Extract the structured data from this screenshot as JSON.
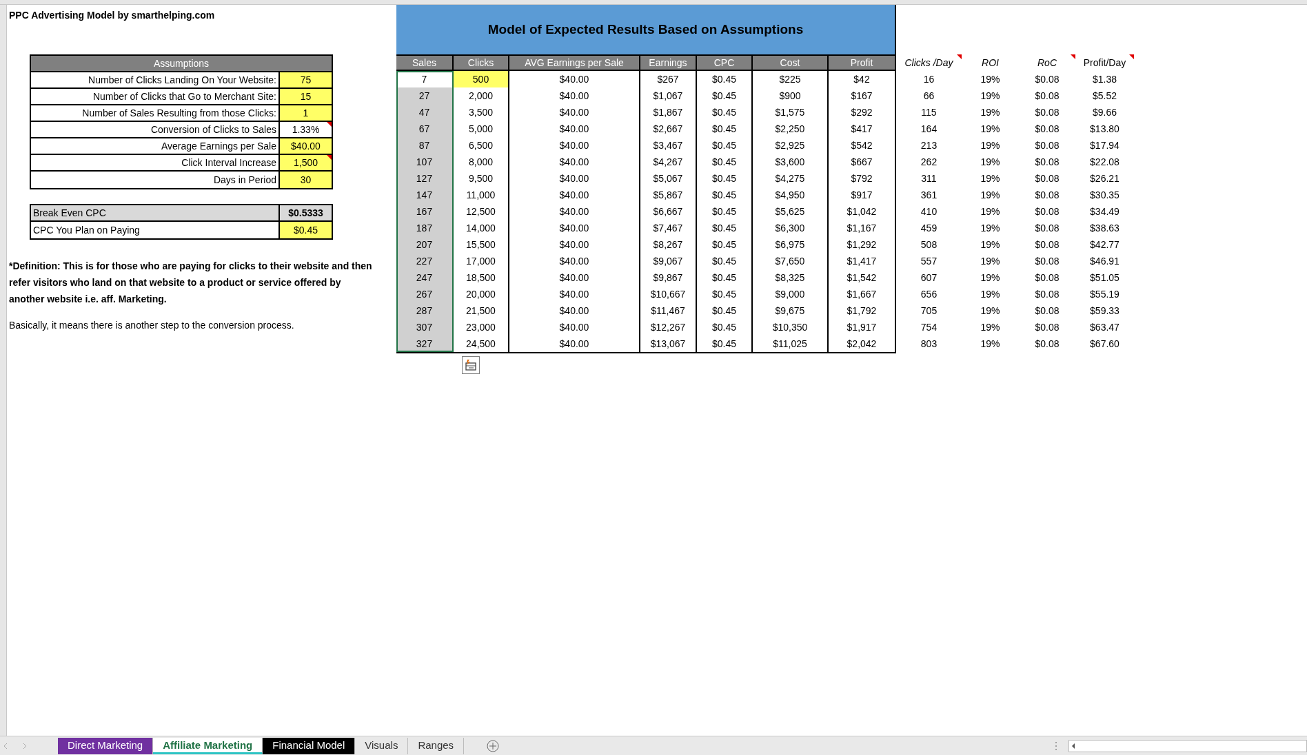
{
  "sheet_title": "PPC Advertising Model by smarthelping.com",
  "assumptions": {
    "title": "Assumptions",
    "rows": [
      {
        "label": "Number of Clicks Landing On Your Website:",
        "value": "75",
        "input": true,
        "comment": false
      },
      {
        "label": "Number of Clicks that Go to Merchant Site:",
        "value": "15",
        "input": true,
        "comment": false
      },
      {
        "label": "Number of Sales Resulting from those Clicks:",
        "value": "1",
        "input": true,
        "comment": false
      },
      {
        "label": "Conversion of Clicks to Sales",
        "value": "1.33%",
        "input": false,
        "comment": true
      },
      {
        "label": "Average Earnings per Sale",
        "value": "$40.00",
        "input": true,
        "comment": false
      },
      {
        "label": "Click Interval Increase",
        "value": "1,500",
        "input": true,
        "comment": true
      },
      {
        "label": "Days in Period",
        "value": "30",
        "input": true,
        "comment": false
      }
    ]
  },
  "cpc": [
    {
      "label": "Break Even CPC",
      "value": "$0.5333",
      "input": false
    },
    {
      "label": "CPC You Plan on Paying",
      "value": "$0.45",
      "input": true
    }
  ],
  "definition": "*Definition: This is for those who are paying for clicks to their website and then refer visitors who land on that website to a product or service offered by another website i.e. aff. Marketing.",
  "note": "Basically, it means there is another step to the conversion process.",
  "model": {
    "title": "Model of Expected Results Based on Assumptions",
    "columns": [
      "Sales",
      "Clicks",
      "AVG Earnings per Sale",
      "Earnings",
      "CPC",
      "Cost",
      "Profit"
    ],
    "extra_columns": [
      {
        "label": "Clicks /Day",
        "italic": true,
        "comment": true
      },
      {
        "label": "ROI",
        "italic": true,
        "comment": false
      },
      {
        "label": "RoC",
        "italic": true,
        "comment": true
      },
      {
        "label": "Profit/Day",
        "italic": false,
        "comment": true
      }
    ],
    "rows": [
      {
        "cells": [
          "7",
          "500",
          "$40.00",
          "$267",
          "$0.45",
          "$225",
          "$42",
          "16",
          "19%",
          "$0.08",
          "$1.38"
        ],
        "sales_in_selection": false,
        "clicks_input": true
      },
      {
        "cells": [
          "27",
          "2,000",
          "$40.00",
          "$1,067",
          "$0.45",
          "$900",
          "$167",
          "66",
          "19%",
          "$0.08",
          "$5.52"
        ],
        "sales_in_selection": true,
        "clicks_input": false
      },
      {
        "cells": [
          "47",
          "3,500",
          "$40.00",
          "$1,867",
          "$0.45",
          "$1,575",
          "$292",
          "115",
          "19%",
          "$0.08",
          "$9.66"
        ],
        "sales_in_selection": true,
        "clicks_input": false
      },
      {
        "cells": [
          "67",
          "5,000",
          "$40.00",
          "$2,667",
          "$0.45",
          "$2,250",
          "$417",
          "164",
          "19%",
          "$0.08",
          "$13.80"
        ],
        "sales_in_selection": true,
        "clicks_input": false
      },
      {
        "cells": [
          "87",
          "6,500",
          "$40.00",
          "$3,467",
          "$0.45",
          "$2,925",
          "$542",
          "213",
          "19%",
          "$0.08",
          "$17.94"
        ],
        "sales_in_selection": true,
        "clicks_input": false
      },
      {
        "cells": [
          "107",
          "8,000",
          "$40.00",
          "$4,267",
          "$0.45",
          "$3,600",
          "$667",
          "262",
          "19%",
          "$0.08",
          "$22.08"
        ],
        "sales_in_selection": true,
        "clicks_input": false
      },
      {
        "cells": [
          "127",
          "9,500",
          "$40.00",
          "$5,067",
          "$0.45",
          "$4,275",
          "$792",
          "311",
          "19%",
          "$0.08",
          "$26.21"
        ],
        "sales_in_selection": true,
        "clicks_input": false
      },
      {
        "cells": [
          "147",
          "11,000",
          "$40.00",
          "$5,867",
          "$0.45",
          "$4,950",
          "$917",
          "361",
          "19%",
          "$0.08",
          "$30.35"
        ],
        "sales_in_selection": true,
        "clicks_input": false
      },
      {
        "cells": [
          "167",
          "12,500",
          "$40.00",
          "$6,667",
          "$0.45",
          "$5,625",
          "$1,042",
          "410",
          "19%",
          "$0.08",
          "$34.49"
        ],
        "sales_in_selection": true,
        "clicks_input": false
      },
      {
        "cells": [
          "187",
          "14,000",
          "$40.00",
          "$7,467",
          "$0.45",
          "$6,300",
          "$1,167",
          "459",
          "19%",
          "$0.08",
          "$38.63"
        ],
        "sales_in_selection": true,
        "clicks_input": false
      },
      {
        "cells": [
          "207",
          "15,500",
          "$40.00",
          "$8,267",
          "$0.45",
          "$6,975",
          "$1,292",
          "508",
          "19%",
          "$0.08",
          "$42.77"
        ],
        "sales_in_selection": true,
        "clicks_input": false
      },
      {
        "cells": [
          "227",
          "17,000",
          "$40.00",
          "$9,067",
          "$0.45",
          "$7,650",
          "$1,417",
          "557",
          "19%",
          "$0.08",
          "$46.91"
        ],
        "sales_in_selection": true,
        "clicks_input": false
      },
      {
        "cells": [
          "247",
          "18,500",
          "$40.00",
          "$9,867",
          "$0.45",
          "$8,325",
          "$1,542",
          "607",
          "19%",
          "$0.08",
          "$51.05"
        ],
        "sales_in_selection": true,
        "clicks_input": false
      },
      {
        "cells": [
          "267",
          "20,000",
          "$40.00",
          "$10,667",
          "$0.45",
          "$9,000",
          "$1,667",
          "656",
          "19%",
          "$0.08",
          "$55.19"
        ],
        "sales_in_selection": true,
        "clicks_input": false
      },
      {
        "cells": [
          "287",
          "21,500",
          "$40.00",
          "$11,467",
          "$0.45",
          "$9,675",
          "$1,792",
          "705",
          "19%",
          "$0.08",
          "$59.33"
        ],
        "sales_in_selection": true,
        "clicks_input": false
      },
      {
        "cells": [
          "307",
          "23,000",
          "$40.00",
          "$12,267",
          "$0.45",
          "$10,350",
          "$1,917",
          "754",
          "19%",
          "$0.08",
          "$63.47"
        ],
        "sales_in_selection": true,
        "clicks_input": false
      },
      {
        "cells": [
          "327",
          "24,500",
          "$40.00",
          "$13,067",
          "$0.45",
          "$11,025",
          "$2,042",
          "803",
          "19%",
          "$0.08",
          "$67.60"
        ],
        "sales_in_selection": true,
        "clicks_input": false
      }
    ]
  },
  "sheet_tabs": [
    {
      "label": "Direct Marketing",
      "color": "#7030a0",
      "selected": false
    },
    {
      "label": "Affiliate Marketing",
      "color": "#2ec4c4",
      "selected": true
    },
    {
      "label": "Financial Model",
      "color": "#000000",
      "selected": false
    },
    {
      "label": "Visuals",
      "selected": false
    },
    {
      "label": "Ranges",
      "selected": false
    }
  ]
}
